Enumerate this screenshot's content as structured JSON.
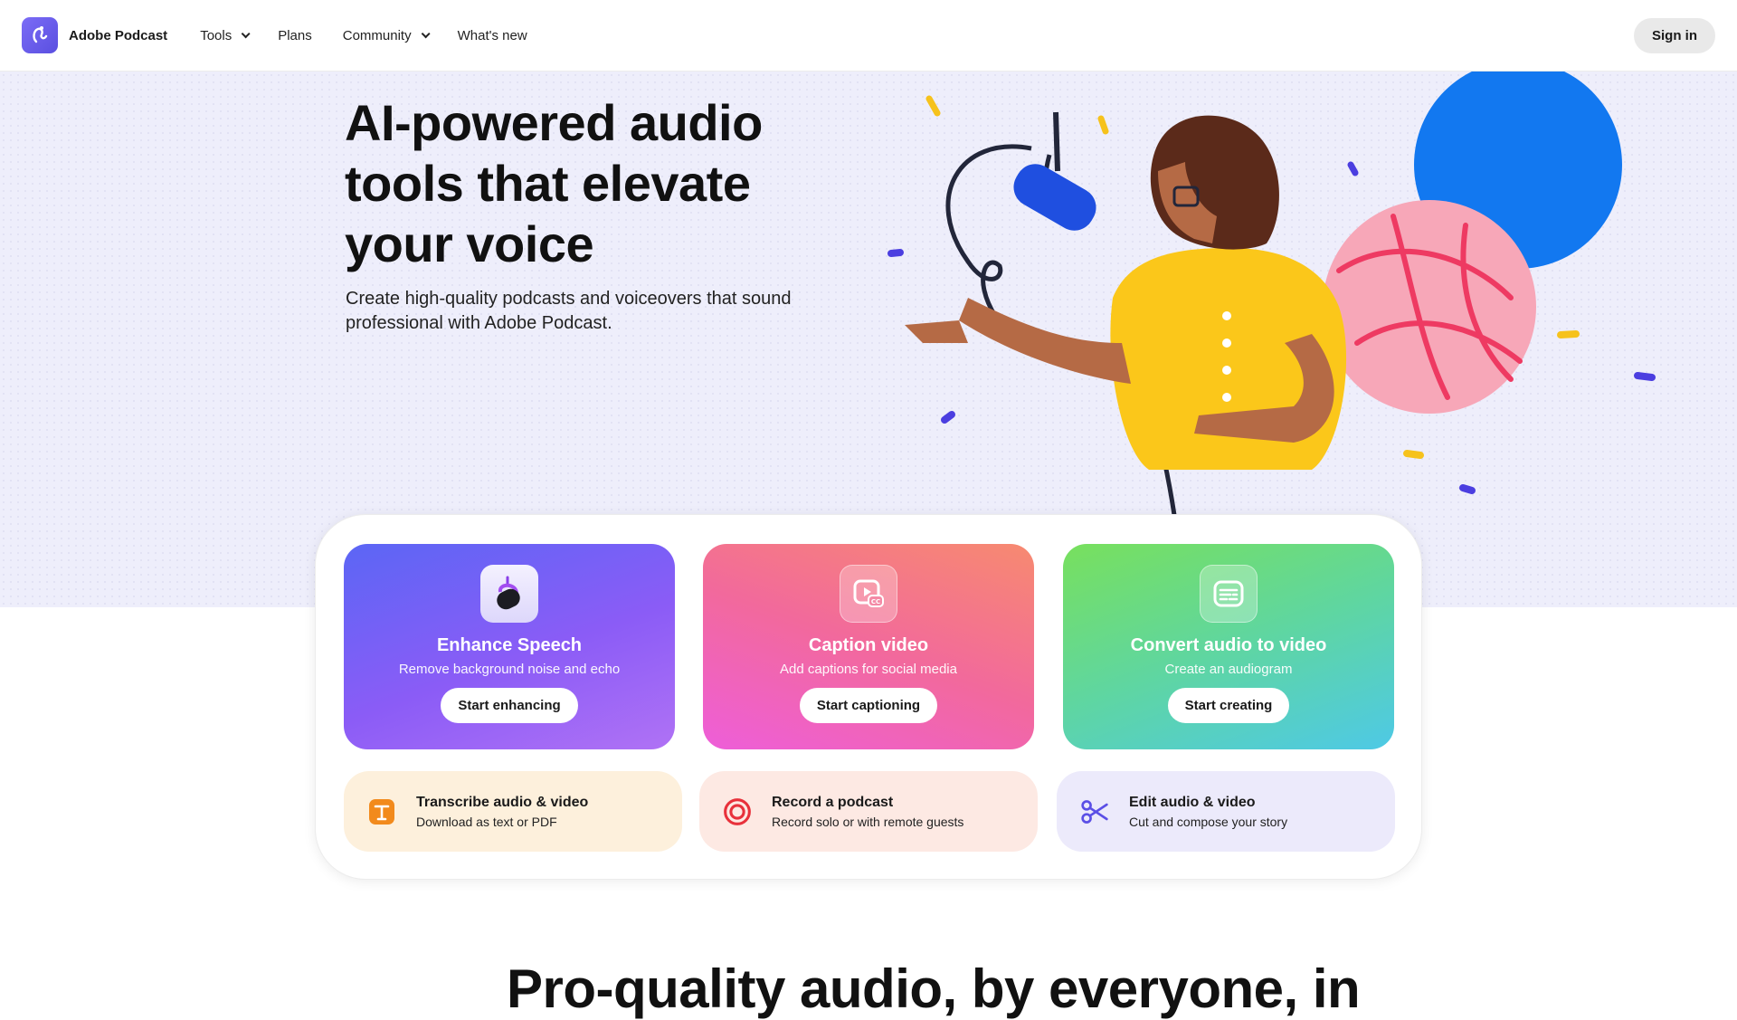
{
  "nav": {
    "brand": "Adobe Podcast",
    "items": [
      {
        "label": "Tools",
        "dropdown": true
      },
      {
        "label": "Plans",
        "dropdown": false
      },
      {
        "label": "Community",
        "dropdown": true
      },
      {
        "label": "What's new",
        "dropdown": false
      }
    ],
    "signin_label": "Sign in"
  },
  "hero": {
    "title": "AI-powered audio tools that elevate your voice",
    "subtitle": "Create high-quality podcasts and voiceovers that sound professional with Adobe Podcast."
  },
  "tools": {
    "primary": [
      {
        "icon": "microphone-icon",
        "title": "Enhance Speech",
        "subtitle": "Remove background noise and echo",
        "button": "Start enhancing"
      },
      {
        "icon": "caption-video-icon",
        "title": "Caption video",
        "subtitle": "Add captions for social media",
        "button": "Start captioning"
      },
      {
        "icon": "audiogram-icon",
        "title": "Convert audio to video",
        "subtitle": "Create an audiogram",
        "button": "Start creating"
      }
    ],
    "secondary": [
      {
        "icon": "transcribe-icon",
        "title": "Transcribe audio & video",
        "subtitle": "Download as text or PDF"
      },
      {
        "icon": "record-icon",
        "title": "Record a podcast",
        "subtitle": "Record solo or with remote guests"
      },
      {
        "icon": "scissors-icon",
        "title": "Edit audio & video",
        "subtitle": "Cut and compose your story"
      }
    ]
  },
  "bottom_heading": "Pro-quality audio, by everyone, in"
}
